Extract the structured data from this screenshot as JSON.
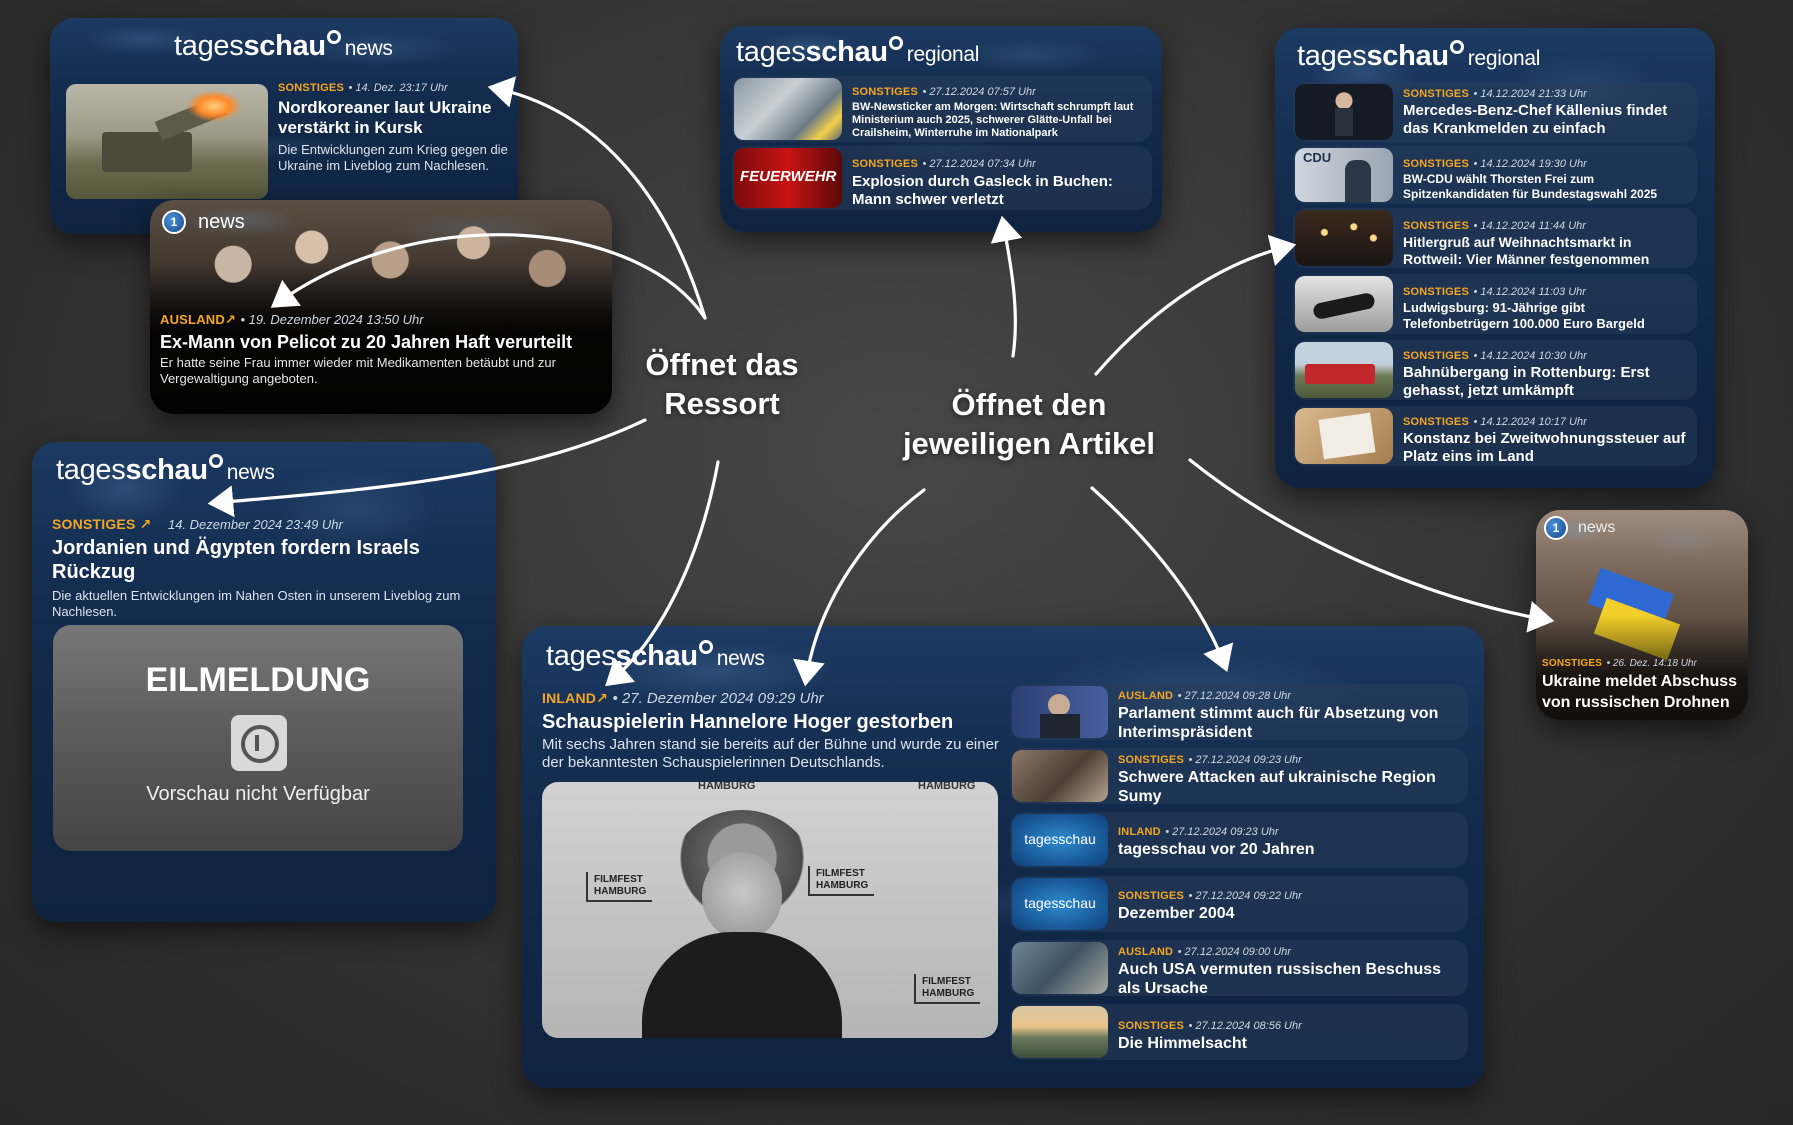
{
  "brand": {
    "name_light": "tages",
    "name_bold": "schau",
    "news": "news",
    "regional": "regional"
  },
  "labels": {
    "ressort_line1": "Öffnet das",
    "ressort_line2": "Ressort",
    "artikel_line1": "Öffnet den",
    "artikel_line2": "jeweiligen Artikel"
  },
  "w1": {
    "category": "SONSTIGES",
    "meta": "• 14. Dez. 23:17 Uhr",
    "title": "Nordkoreaner laut Ukraine verstärkt in Kursk",
    "teaser": "Die Entwicklungen zum Krieg gegen die Ukraine im Liveblog zum Nachlesen."
  },
  "w2": {
    "badge": "news",
    "category": "AUSLAND↗",
    "meta": "• 19. Dezember 2024 13:50 Uhr",
    "title": "Ex-Mann von Pelicot zu 20 Jahren Haft verurteilt",
    "teaser": "Er hatte seine Frau immer wieder mit Medikamenten betäubt und zur Vergewaltigung angeboten."
  },
  "w3": {
    "category": "SONSTIGES ↗",
    "meta": "14. Dezember 2024 23:49 Uhr",
    "title": "Jordanien und Ägypten fordern Israels Rückzug",
    "teaser": "Die aktuellen Entwicklungen im Nahen Osten in unserem Liveblog zum Nachlesen.",
    "eil_title": "EILMELDUNG",
    "eil_sub": "Vorschau nicht Verfügbar"
  },
  "w4": {
    "items": [
      {
        "category": "SONSTIGES",
        "meta": "• 27.12.2024 07:57 Uhr",
        "title": "BW-Newsticker am Morgen: Wirtschaft schrumpft laut Ministerium auch 2025, schwerer Glätte-Unfall bei Crailsheim, Winterruhe im Nationalpark"
      },
      {
        "category": "SONSTIGES",
        "meta": "• 27.12.2024 07:34 Uhr",
        "title": "Explosion durch Gasleck in Buchen: Mann schwer verletzt"
      }
    ],
    "thumb2_text": "FEUERWEHR"
  },
  "w5": {
    "items": [
      {
        "category": "SONSTIGES",
        "meta": "• 14.12.2024 21:33 Uhr",
        "title": "Mercedes-Benz-Chef Källenius findet das Krankmelden zu einfach"
      },
      {
        "category": "SONSTIGES",
        "meta": "• 14.12.2024 19:30 Uhr",
        "title": "BW-CDU wählt Thorsten Frei zum Spitzenkandidaten für Bundestagswahl 2025"
      },
      {
        "category": "SONSTIGES",
        "meta": "• 14.12.2024 11:44 Uhr",
        "title": "Hitlergruß auf Weihnachtsmarkt in Rottweil: Vier Männer festgenommen"
      },
      {
        "category": "SONSTIGES",
        "meta": "• 14.12.2024 11:03 Uhr",
        "title": "Ludwigsburg: 91-Jährige gibt Telefonbetrügern 100.000 Euro Bargeld"
      },
      {
        "category": "SONSTIGES",
        "meta": "• 14.12.2024 10:30 Uhr",
        "title": "Bahnübergang in Rottenburg: Erst gehasst, jetzt umkämpft"
      },
      {
        "category": "SONSTIGES",
        "meta": "• 14.12.2024 10:17 Uhr",
        "title": "Konstanz bei Zweitwohnungssteuer auf Platz eins im Land"
      }
    ],
    "cdu": "CDU"
  },
  "w6": {
    "badge": "news",
    "category": "SONSTIGES",
    "meta": "• 26. Dez. 14:18 Uhr",
    "title": "Ukraine meldet Abschuss von russischen Drohnen"
  },
  "w7": {
    "category": "INLAND↗",
    "meta": "• 27. Dezember 2024 09:29 Uhr",
    "title": "Schauspielerin Hannelore Hoger gestorben",
    "teaser": "Mit sechs Jahren stand sie bereits auf der Bühne und wurde zu einer der bekanntesten Schauspielerinnen Deutschlands.",
    "photo_top": "HAMBURG",
    "photo_top2": "HAMBURG",
    "filmfest": "FILMFEST",
    "hamburg": "HAMBURG",
    "items": [
      {
        "category": "AUSLAND",
        "meta": "• 27.12.2024 09:28 Uhr",
        "title": "Parlament stimmt auch für Absetzung von Interimspräsident"
      },
      {
        "category": "SONSTIGES",
        "meta": "• 27.12.2024 09:23 Uhr",
        "title": "Schwere Attacken auf ukrainische Region Sumy"
      },
      {
        "category": "INLAND",
        "meta": "• 27.12.2024 09:23 Uhr",
        "title": "tagesschau vor 20 Jahren"
      },
      {
        "category": "SONSTIGES",
        "meta": "• 27.12.2024 09:22 Uhr",
        "title": "Dezember 2004"
      },
      {
        "category": "AUSLAND",
        "meta": "• 27.12.2024 09:00 Uhr",
        "title": "Auch USA vermuten russischen Beschuss als Ursache"
      },
      {
        "category": "SONSTIGES",
        "meta": "• 27.12.2024 08:56 Uhr",
        "title": "Die Himmelsacht"
      }
    ],
    "thumb_logo": "tagesschau"
  }
}
